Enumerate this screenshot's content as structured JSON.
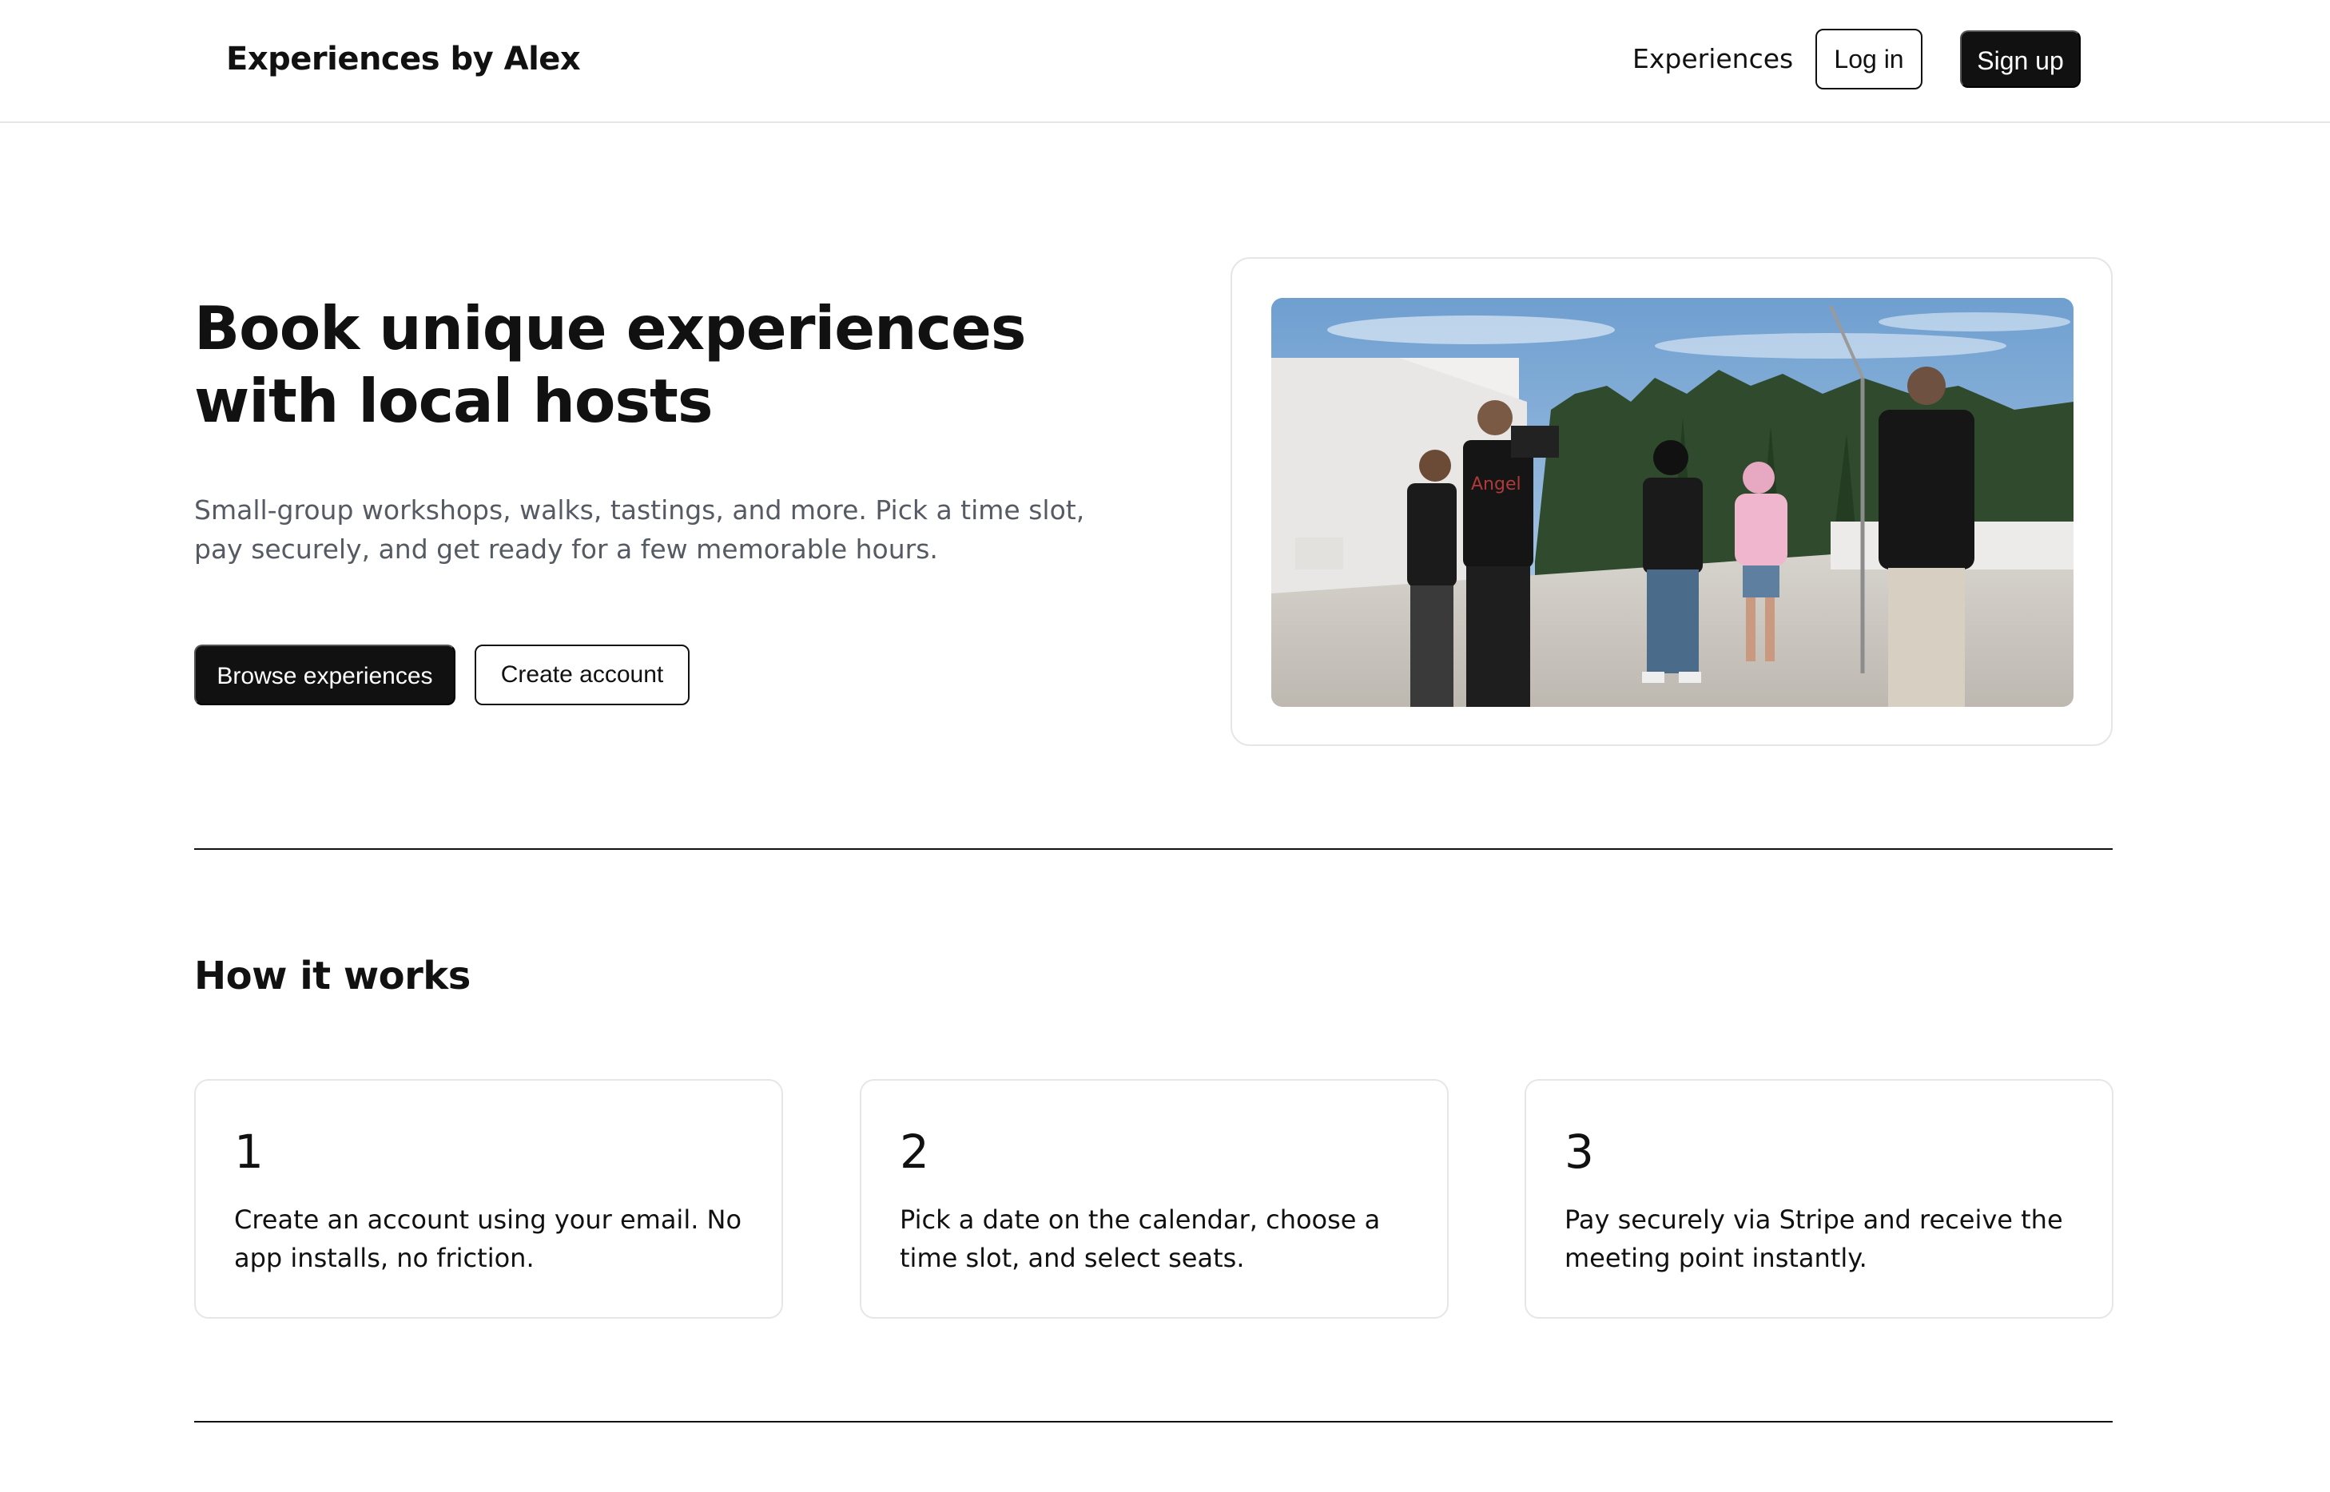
{
  "header": {
    "brand": "Experiences by Alex",
    "nav_experiences": "Experiences",
    "login_label": "Log in",
    "signup_label": "Sign up"
  },
  "hero": {
    "title": "Book unique experiences with local hosts",
    "subtitle": "Small-group workshops, walks, tastings, and more. Pick a time slot, pay securely, and get ready for a few memorable hours.",
    "browse_label": "Browse experiences",
    "create_label": "Create account",
    "photo_shirt_text": "Angel"
  },
  "how_it_works": {
    "title": "How it works",
    "steps": [
      {
        "number": "1",
        "text": "Create an account using your email. No app installs, no friction."
      },
      {
        "number": "2",
        "text": "Pick a date on the calendar, choose a time slot, and select seats."
      },
      {
        "number": "3",
        "text": "Pay securely via Stripe and receive the meeting point instantly."
      }
    ]
  },
  "colors": {
    "text": "#111111",
    "muted": "#555a63",
    "border": "#e6e6e6",
    "primary_button": "#111111"
  }
}
